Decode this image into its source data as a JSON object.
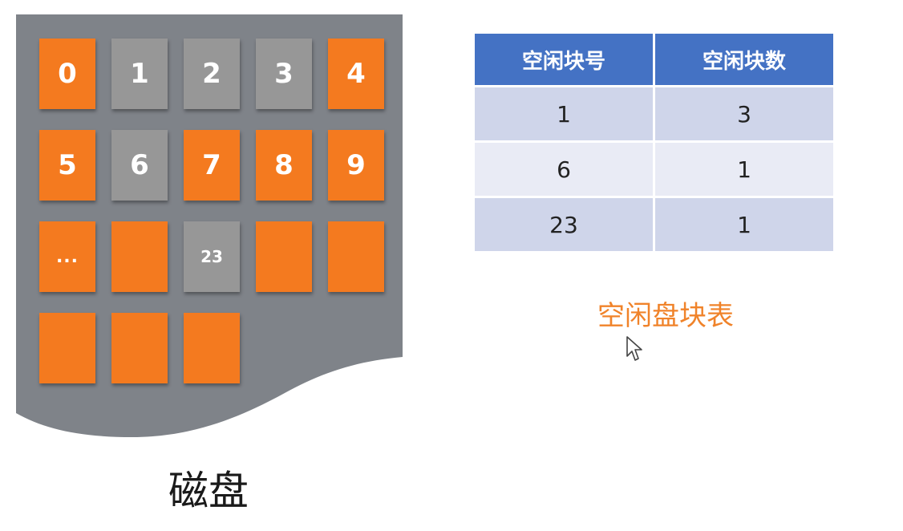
{
  "colors": {
    "disk_bg": "#7f8389",
    "used_block": "#f47a1f",
    "free_block": "#979797",
    "table_header": "#4472c4",
    "row_odd": "#cfd5ea",
    "row_even": "#e9ebf5",
    "caption_accent": "#f0832a"
  },
  "disk": {
    "caption": "磁盘",
    "blocks": [
      {
        "label": "0",
        "status": "used"
      },
      {
        "label": "1",
        "status": "free"
      },
      {
        "label": "2",
        "status": "free"
      },
      {
        "label": "3",
        "status": "free"
      },
      {
        "label": "4",
        "status": "used"
      },
      {
        "label": "5",
        "status": "used"
      },
      {
        "label": "6",
        "status": "free"
      },
      {
        "label": "7",
        "status": "used"
      },
      {
        "label": "8",
        "status": "used"
      },
      {
        "label": "9",
        "status": "used"
      },
      {
        "label": "...",
        "status": "used"
      },
      {
        "label": "",
        "status": "used"
      },
      {
        "label": "23",
        "status": "free"
      },
      {
        "label": "",
        "status": "used"
      },
      {
        "label": "",
        "status": "used"
      },
      {
        "label": "",
        "status": "used"
      },
      {
        "label": "",
        "status": "used"
      },
      {
        "label": "",
        "status": "used"
      }
    ]
  },
  "free_table": {
    "caption": "空闲盘块表",
    "headers": [
      "空闲块号",
      "空闲块数"
    ],
    "rows": [
      [
        "1",
        "3"
      ],
      [
        "6",
        "1"
      ],
      [
        "23",
        "1"
      ]
    ]
  }
}
